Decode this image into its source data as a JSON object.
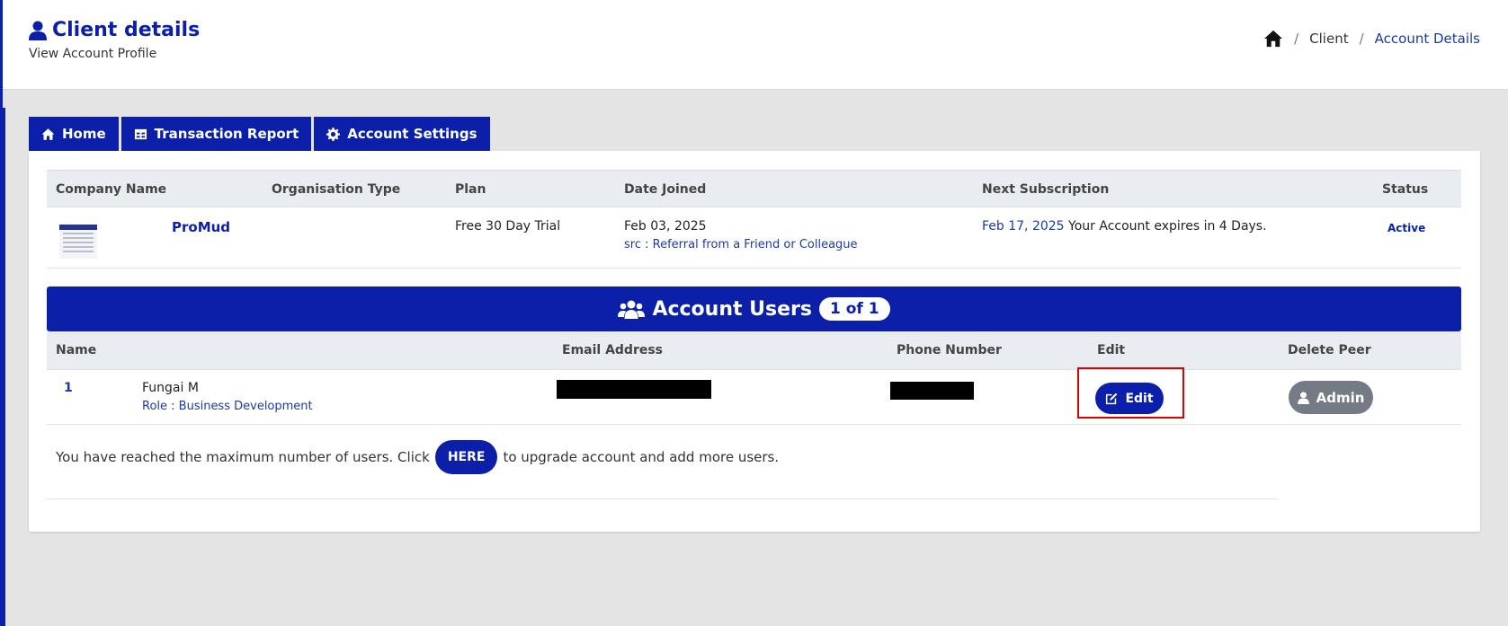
{
  "header": {
    "title": "Client details",
    "subtitle": "View Account Profile",
    "title_icon": "user-icon"
  },
  "breadcrumb": {
    "home_icon": "home-icon",
    "sep": "/",
    "items": [
      "Client",
      "Account Details"
    ]
  },
  "tabs": [
    {
      "label": "Home",
      "icon": "home-icon"
    },
    {
      "label": "Transaction Report",
      "icon": "table-icon"
    },
    {
      "label": "Account Settings",
      "icon": "gear-icon"
    }
  ],
  "account": {
    "columns": [
      "Company Name",
      "Organisation Type",
      "Plan",
      "Date Joined",
      "Next Subscription",
      "Status"
    ],
    "company_name": "ProMud",
    "organisation_type": "",
    "plan": "Free 30 Day Trial",
    "date_joined": "Feb 03, 2025",
    "source": "src : Referral from a Friend or Colleague",
    "next_subscription_date": "Feb 17, 2025",
    "next_subscription_note": "Your Account expires in 4 Days.",
    "status": "Active"
  },
  "users": {
    "title": "Account Users",
    "count": "1 of 1",
    "title_icon": "users-icon",
    "columns": [
      "Name",
      "Email Address",
      "Phone Number",
      "Edit",
      "Delete Peer"
    ],
    "rows": [
      {
        "index": "1",
        "name": "Fungai M",
        "role": "Role : Business Development",
        "edit_label": "Edit",
        "admin_label": "Admin"
      }
    ]
  },
  "notice": {
    "before": "You have reached the maximum number of users. Click",
    "button": "HERE",
    "after": "to upgrade account and add more users."
  },
  "colors": {
    "primary": "#0b1fa8",
    "admin_grey": "#747b84",
    "highlight_red": "#e00000"
  }
}
